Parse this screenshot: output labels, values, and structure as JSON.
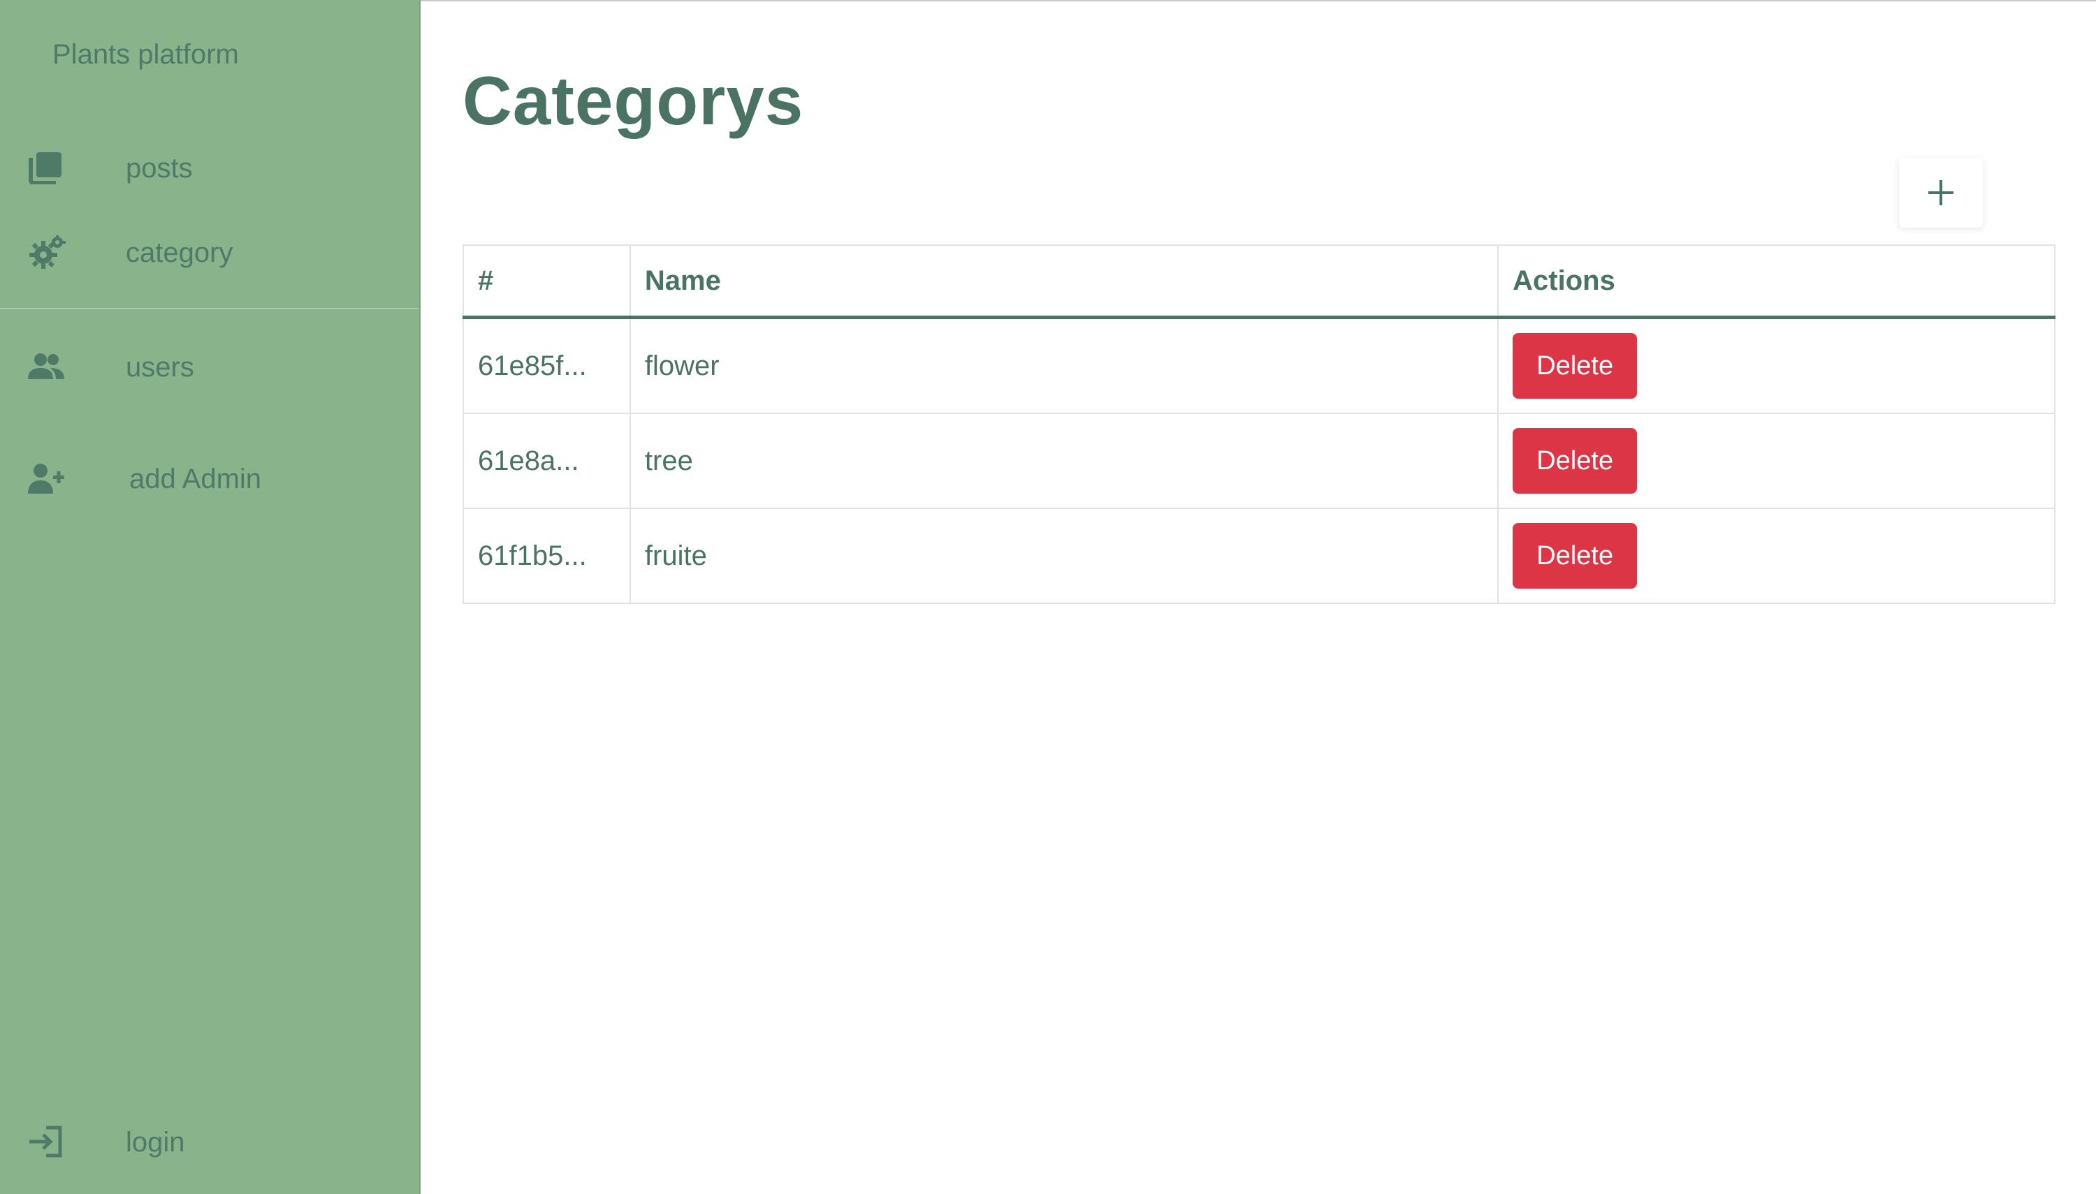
{
  "sidebar": {
    "brand": "Plants platform",
    "items": [
      {
        "label": "posts",
        "icon": "copy-icon"
      },
      {
        "label": "category",
        "icon": "gear-icon"
      },
      {
        "label": "users",
        "icon": "users-icon"
      },
      {
        "label": "add Admin",
        "icon": "user-plus-icon"
      },
      {
        "label": "login",
        "icon": "sign-in-icon"
      }
    ]
  },
  "main": {
    "title": "Categorys",
    "add_icon": "plus-icon",
    "table": {
      "headers": [
        "#",
        "Name",
        "Actions"
      ],
      "rows": [
        {
          "id": "61e85f...",
          "name": "flower",
          "action": "Delete"
        },
        {
          "id": "61e8a...",
          "name": "tree",
          "action": "Delete"
        },
        {
          "id": "61f1b5...",
          "name": "fruite",
          "action": "Delete"
        }
      ]
    }
  },
  "colors": {
    "sidebar_bg": "#89b38a",
    "text": "#4a7364",
    "danger": "#dc3545"
  }
}
